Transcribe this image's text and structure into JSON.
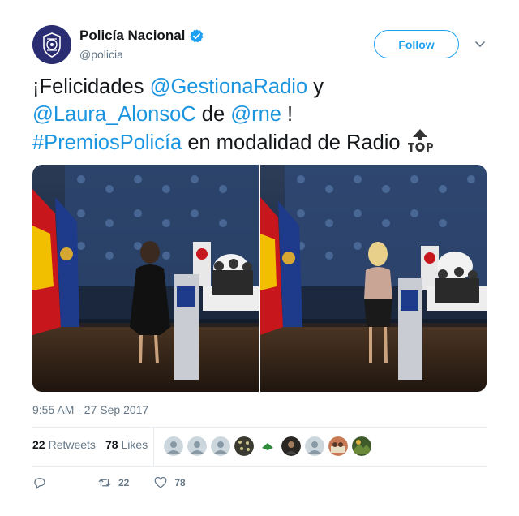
{
  "account": {
    "display_name": "Policía Nacional",
    "handle": "@policia",
    "verified_icon": "verified-badge-icon"
  },
  "follow_button": {
    "label": "Follow"
  },
  "tweet": {
    "line1_pre": "¡Felicidades ",
    "mention1": "@GestionaRadio",
    "line1_post": "  y",
    "mention2": "@Laura_AlonsoC",
    "line2_mid": " de ",
    "mention3": "@rne",
    "line2_post": " !",
    "hashtag": "#PremiosPolicía",
    "line3_post": " en modalidad de Radio",
    "emoji": "top-arrow-emoji"
  },
  "media": {
    "photos": [
      "photo-speaker-dark-dress",
      "photo-speaker-light-top"
    ]
  },
  "timestamp": "9:55 AM - 27 Sep 2017",
  "stats": {
    "retweets_count": "22",
    "retweets_label": "Retweets",
    "likes_count": "78",
    "likes_label": "Likes"
  },
  "actions": {
    "reply_icon": "reply-icon",
    "retweet_count": "22",
    "like_count": "78"
  },
  "colors": {
    "link": "#1b95e0",
    "follow": "#1da1f2",
    "muted": "#657786",
    "text": "#14171a"
  }
}
